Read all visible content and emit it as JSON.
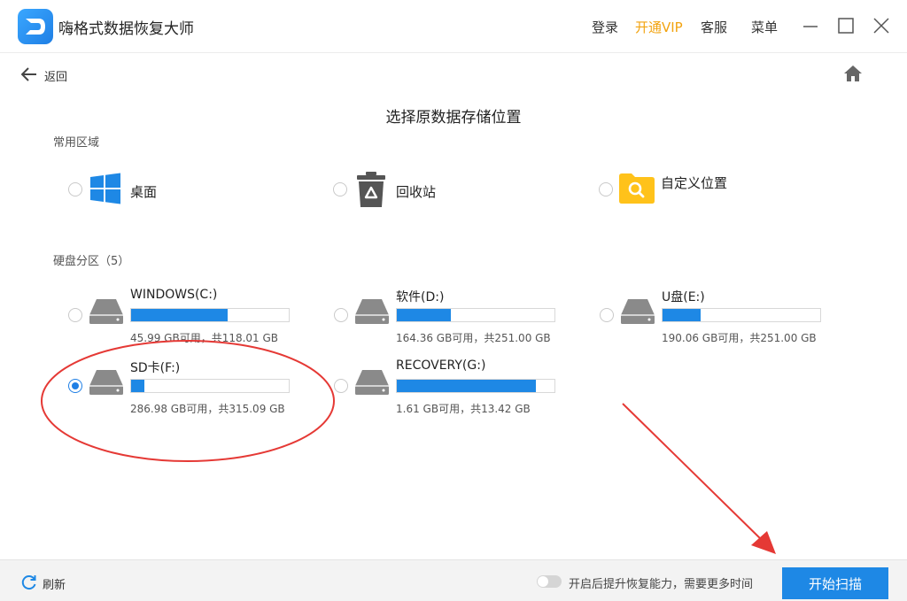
{
  "app": {
    "title": "嗨格式数据恢复大师"
  },
  "titlebar": {
    "login": "登录",
    "vip": "开通VIP",
    "service": "客服",
    "menu": "菜单"
  },
  "nav": {
    "back_label": "返回"
  },
  "page": {
    "title": "选择原数据存储位置"
  },
  "common": {
    "label": "常用区域",
    "items": [
      {
        "label": "桌面",
        "icon": "windows-icon"
      },
      {
        "label": "回收站",
        "icon": "recycle-bin-icon"
      },
      {
        "label": "自定义位置",
        "icon": "folder-search-icon"
      }
    ]
  },
  "drives": {
    "label": "硬盘分区（5）",
    "items": [
      {
        "name": "WINDOWS(C:)",
        "info": "45.99 GB可用，共118.01 GB",
        "used_fraction": 0.61,
        "selected": false
      },
      {
        "name": "软件(D:)",
        "info": "164.36 GB可用，共251.00 GB",
        "used_fraction": 0.345,
        "selected": false
      },
      {
        "name": "U盘(E:)",
        "info": "190.06 GB可用，共251.00 GB",
        "used_fraction": 0.243,
        "selected": false
      },
      {
        "name": "SD卡(F:)",
        "info": "286.98 GB可用，共315.09 GB",
        "used_fraction": 0.083,
        "selected": true
      },
      {
        "name": "RECOVERY(G:)",
        "info": "1.61 GB可用，共13.42 GB",
        "used_fraction": 0.88,
        "selected": false
      }
    ]
  },
  "footer": {
    "refresh_label": "刷新",
    "toggle_label": "开启后提升恢复能力，需要更多时间",
    "scan_button": "开始扫描"
  },
  "colors": {
    "accent": "#1e88e5",
    "vip": "#f2a30f",
    "annotation": "#e53935",
    "folder": "#ffc21a"
  }
}
